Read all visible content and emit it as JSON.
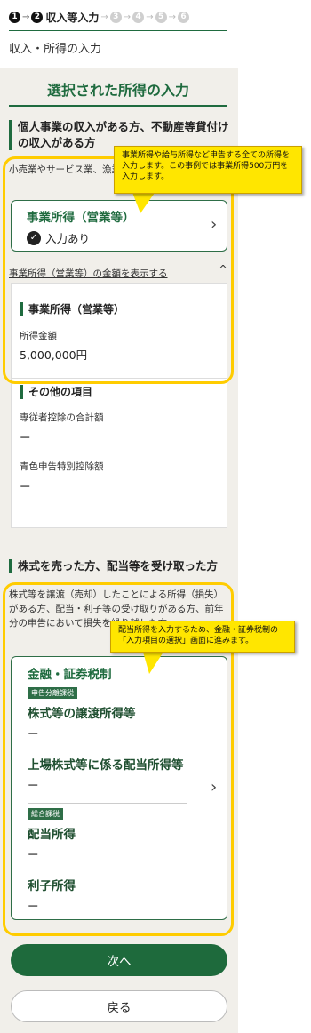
{
  "steps": {
    "marker1": "1",
    "marker2": "2",
    "current_label": "収入等入力",
    "marker3": "3",
    "marker4": "4",
    "marker5": "5",
    "marker6": "6"
  },
  "page_title": "収入・所得の入力",
  "section_title": "選択された所得の入力",
  "business": {
    "heading": "個人事業の収入がある方、不動産等貸付けの収入がある方",
    "description": "小売業やサービス業、漁業などの事業所得がある方",
    "card_title": "事業所得（営業等）",
    "status": "入力あり",
    "toggle_link": "事業所得（営業等）の金額を表示する",
    "detail_heading": "事業所得（営業等）",
    "amount_label": "所得金額",
    "amount_value": "5,000,000円",
    "other_heading": "その他の項目",
    "item1_label": "専従者控除の合計額",
    "item1_value": "ー",
    "item2_label": "青色申告特別控除額",
    "item2_value": "ー"
  },
  "stocks": {
    "heading": "株式を売った方、配当等を受け取った方",
    "description": "株式等を譲渡（売却）したことによる所得（損失）がある方、配当・利子等の受け取りがある方、前年分の申告において損失を繰り越した方",
    "card_title": "金融・証券税制",
    "badge_separate": "申告分離課税",
    "row1_label": "株式等の譲渡所得等",
    "row1_value": "ー",
    "row2_label": "上場株式等に係る配当所得等",
    "row2_value": "ー",
    "badge_comprehensive": "総合課税",
    "row3_label": "配当所得",
    "row3_value": "ー",
    "row4_label": "利子所得",
    "row4_value": "ー"
  },
  "buttons": {
    "next": "次へ",
    "back": "戻る"
  },
  "callouts": {
    "callout1": "事業所得や給与所得など申告する全ての所得を入力します。この事例では事業所得500万円を入力します。",
    "callout2": "配当所得を入力するため、金融・証券税制の「入力項目の選択」画面に進みます。"
  },
  "colors": {
    "primary_green": "#1f6b3f",
    "highlight_yellow": "#ffcc00",
    "callout_yellow": "#ffe600",
    "panel_bg": "#f1efea"
  }
}
